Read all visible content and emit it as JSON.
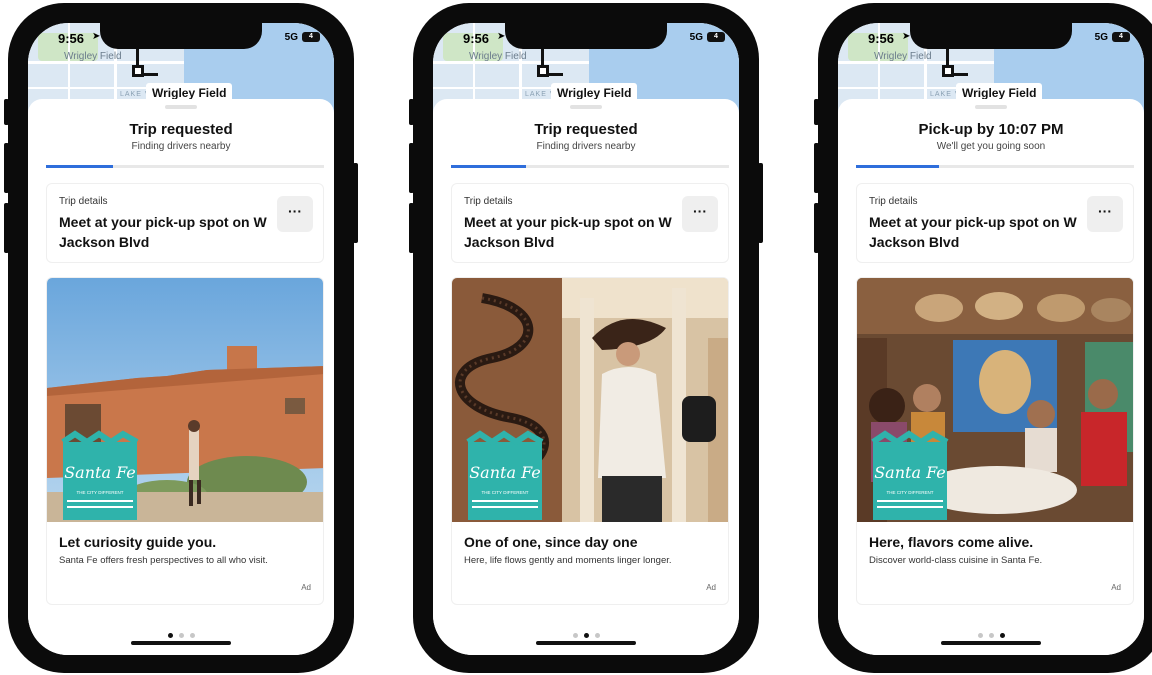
{
  "status_bar": {
    "time": "9:56",
    "network": "5G",
    "battery": "4"
  },
  "map": {
    "area_label": "Wrigley Field",
    "place_label": "Wrigley Field",
    "small_label": "LAKE VIE"
  },
  "phones": [
    {
      "trip": {
        "title": "Trip requested",
        "subtitle": "Finding drivers nearby",
        "progress": 0.24
      },
      "details": {
        "label": "Trip details",
        "text": "Meet at your pick-up spot on W Jackson Blvd"
      },
      "ad": {
        "title": "Let curiosity guide you.",
        "description": "Santa Fe offers fresh perspectives to all who visit.",
        "tag": "Ad",
        "brand_script": "Santa Fe",
        "brand_tagline": "THE CITY DIFFERENT"
      },
      "active_dot": 0
    },
    {
      "trip": {
        "title": "Trip requested",
        "subtitle": "Finding drivers nearby",
        "progress": 0.27
      },
      "details": {
        "label": "Trip details",
        "text": "Meet at your pick-up spot on W Jackson Blvd"
      },
      "ad": {
        "title": "One of one, since day one",
        "description": "Here, life flows gently and moments linger longer.",
        "tag": "Ad",
        "brand_script": "Santa Fe",
        "brand_tagline": "THE CITY DIFFERENT"
      },
      "active_dot": 1
    },
    {
      "trip": {
        "title": "Pick-up by 10:07 PM",
        "subtitle": "We'll get you going soon",
        "progress": 0.3
      },
      "details": {
        "label": "Trip details",
        "text": "Meet at your pick-up spot on W Jackson Blvd"
      },
      "ad": {
        "title": "Here, flavors come alive.",
        "description": "Discover world-class cuisine in Santa Fe.",
        "tag": "Ad",
        "brand_script": "Santa Fe",
        "brand_tagline": "THE CITY DIFFERENT"
      },
      "active_dot": 2
    }
  ],
  "more_icon": "ellipsis-icon",
  "colors": {
    "accent": "#2f6edb",
    "brand_teal": "#2fb3ab",
    "map_water": "#a9cdee"
  }
}
